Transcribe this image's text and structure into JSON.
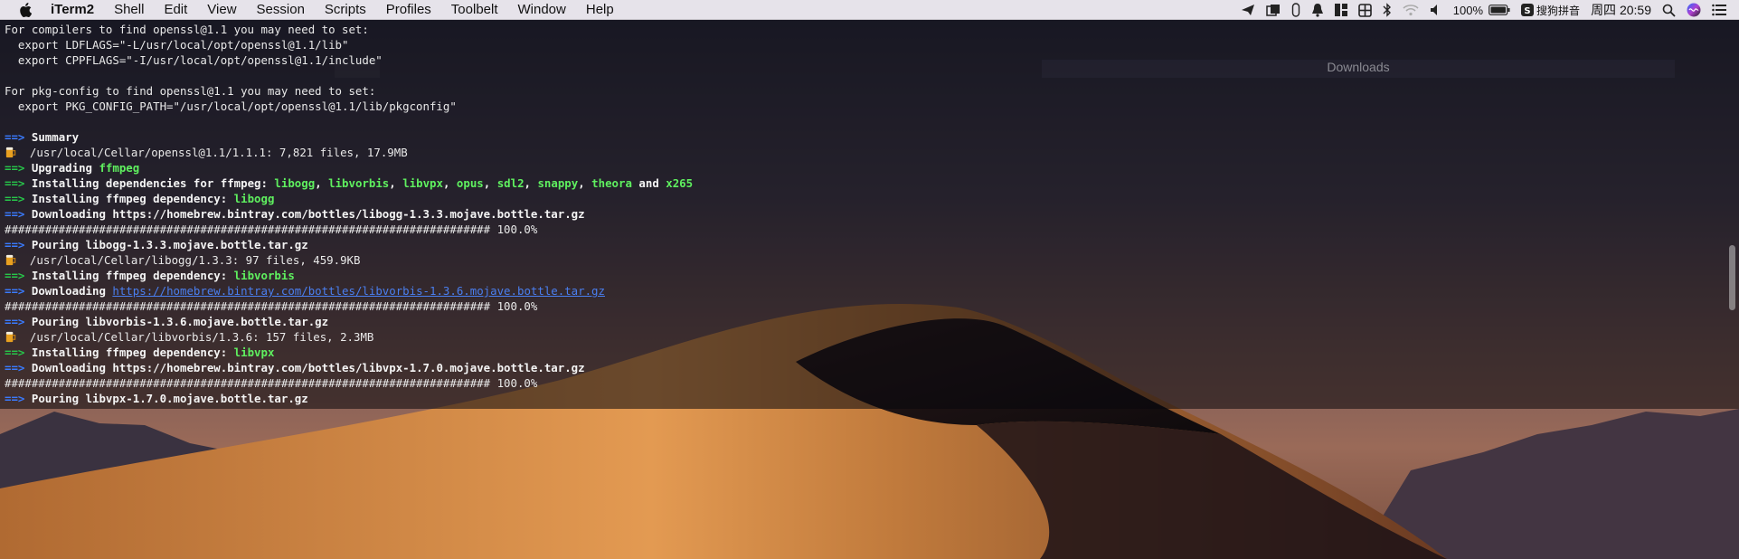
{
  "menubar": {
    "app_name": "iTerm2",
    "items": [
      "Shell",
      "Edit",
      "View",
      "Session",
      "Scripts",
      "Profiles",
      "Toolbelt",
      "Window",
      "Help"
    ],
    "battery_percent": "100%",
    "input_method": "搜狗拼音",
    "clock": "周四 20:59"
  },
  "background_window": {
    "title": "Downloads"
  },
  "terminal": {
    "l1": "For compilers to find openssl@1.1 you may need to set:",
    "l2": "  export LDFLAGS=\"-L/usr/local/opt/openssl@1.1/lib\"",
    "l3": "  export CPPFLAGS=\"-I/usr/local/opt/openssl@1.1/include\"",
    "l5": "For pkg-config to find openssl@1.1 you may need to set:",
    "l6": "  export PKG_CONFIG_PATH=\"/usr/local/opt/openssl@1.1/lib/pkgconfig\"",
    "arrow": "==>",
    "summary": "Summary",
    "cellar_openssl": "/usr/local/Cellar/openssl@1.1/1.1.1: 7,821 files, 17.9MB",
    "upgrading": "Upgrading",
    "ffmpeg": "ffmpeg",
    "installing_deps": "Installing dependencies for ffmpeg:",
    "deps": [
      "libogg",
      "libvorbis",
      "libvpx",
      "opus",
      "sdl2",
      "snappy",
      "theora",
      "x265"
    ],
    "comma": ",",
    "and": "and",
    "installing_dep": "Installing ffmpeg dependency:",
    "libogg": "libogg",
    "libvorbis": "libvorbis",
    "libvpx": "libvpx",
    "downloading": "Downloading",
    "dl_libogg_url": "https://homebrew.bintray.com/bottles/libogg-1.3.3.mojave.bottle.tar.gz",
    "dl_libvorbis_url": "https://homebrew.bintray.com/bottles/libvorbis-1.3.6.mojave.bottle.tar.gz",
    "dl_libvpx_url": "https://homebrew.bintray.com/bottles/libvpx-1.7.0.mojave.bottle.tar.gz",
    "progress_bar": "######################################################################## 100.0%",
    "pour_libogg": "Pouring libogg-1.3.3.mojave.bottle.tar.gz",
    "cellar_libogg": "/usr/local/Cellar/libogg/1.3.3: 97 files, 459.9KB",
    "pour_libvorbis": "Pouring libvorbis-1.3.6.mojave.bottle.tar.gz",
    "cellar_libvorbis": "/usr/local/Cellar/libvorbis/1.3.6: 157 files, 2.3MB",
    "pour_libvpx": "Pouring libvpx-1.7.0.mojave.bottle.tar.gz"
  },
  "colors": {
    "arrow_blue": "#3a7bff",
    "arrow_green": "#27c64a",
    "package_green": "#5ff05f",
    "link_blue": "#4a7ff0"
  },
  "icons": [
    "apple-logo-icon",
    "paper-plane-icon",
    "stack-icon",
    "capsule-icon",
    "bell-icon",
    "grid-icon",
    "table-icon",
    "bluetooth-icon",
    "wifi-icon",
    "volume-icon",
    "battery-icon",
    "sogou-icon",
    "search-icon",
    "siri-icon",
    "list-icon",
    "beer-icon"
  ]
}
